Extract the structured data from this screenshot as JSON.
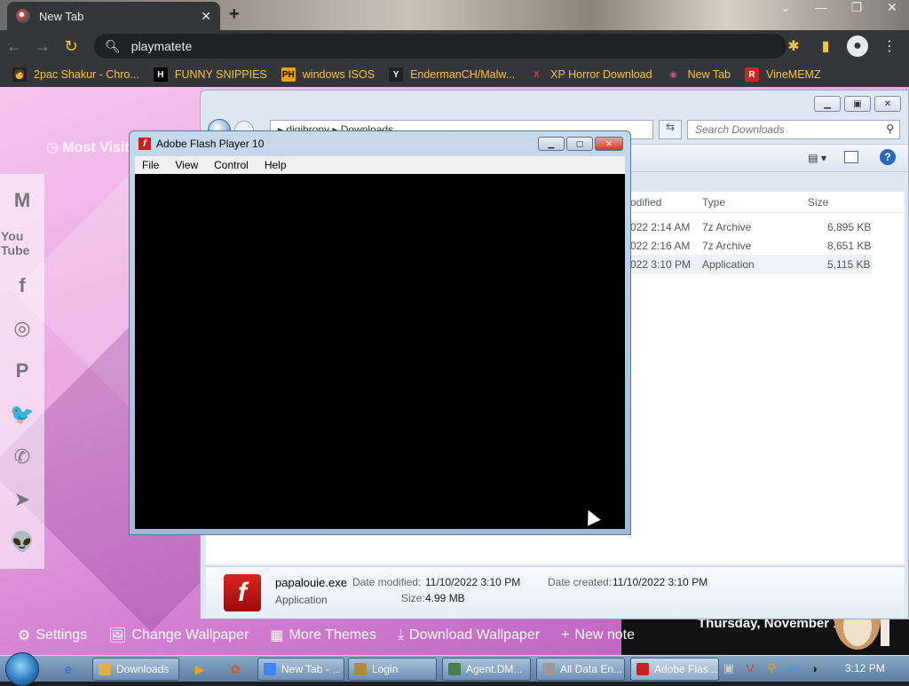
{
  "browser": {
    "tab_title": "New Tab",
    "tab_close": "✕",
    "new_tab_glyph": "+",
    "win_controls": [
      "⌄",
      "—",
      "❐",
      "✕"
    ],
    "omnibox_text": "playmatete",
    "bookmarks": [
      {
        "label": "2pac Shakur - Chro...",
        "icon": "🧑",
        "icon_bg": "#222",
        "icon_color": "#f5c242"
      },
      {
        "label": "FUNNY SNIPPIES",
        "icon": "H",
        "icon_bg": "#000",
        "icon_color": "#fff"
      },
      {
        "label": "windows ISOS",
        "icon": "PH",
        "icon_bg": "#f5a000",
        "icon_color": "#000"
      },
      {
        "label": "EndermanCH/Malw...",
        "icon": "Y",
        "icon_bg": "#222",
        "icon_color": "#fff"
      },
      {
        "label": "XP Horror Download",
        "icon": "X",
        "icon_bg": "transparent",
        "icon_color": "#e53935"
      },
      {
        "label": "New Tab",
        "icon": "◉",
        "icon_bg": "transparent",
        "icon_color": "#c58"
      },
      {
        "label": "VineMEMZ",
        "icon": "R",
        "icon_bg": "#c62828",
        "icon_color": "#fff"
      }
    ]
  },
  "ntp": {
    "most_visited": "Most Visit",
    "social": [
      "M",
      "You Tube",
      "f",
      "◎",
      "P",
      "🐦",
      "✆",
      "➤",
      "👽"
    ],
    "bottom": [
      {
        "icon": "⚙",
        "label": "Settings"
      },
      {
        "icon": "🖼",
        "label": "Change Wallpaper"
      },
      {
        "icon": "▦",
        "label": "More Themes"
      },
      {
        "icon": "⤓",
        "label": "Download Wallpaper"
      },
      {
        "icon": "+",
        "label": "New note"
      }
    ],
    "date": "Thursday, November 10"
  },
  "explorer": {
    "address": "▸ digibrony ▸ Downloads",
    "search_placeholder": "Search Downloads",
    "columns": {
      "modified": "odified",
      "type": "Type",
      "size": "Size"
    },
    "rows": [
      {
        "modified": "022 2:14 AM",
        "type": "7z Archive",
        "size": "6,895 KB",
        "selected": false
      },
      {
        "modified": "022 2:16 AM",
        "type": "7z Archive",
        "size": "8,651 KB",
        "selected": false
      },
      {
        "modified": "022 3:10 PM",
        "type": "Application",
        "size": "5,115 KB",
        "selected": true
      }
    ],
    "details": {
      "name": "papalouie.exe",
      "type": "Application",
      "modified_label": "Date modified:",
      "modified_value": "11/10/2022 3:10 PM",
      "created_label": "Date created:",
      "created_value": "11/10/2022 3:10 PM",
      "size_label": "Size:",
      "size_value": "4.99 MB"
    }
  },
  "flash": {
    "title": "Adobe Flash Player 10",
    "menu": [
      "File",
      "View",
      "Control",
      "Help"
    ]
  },
  "taskbar": {
    "buttons": [
      {
        "label": "Downloads",
        "icon_bg": "#e0b040"
      },
      {
        "label": "New Tab - ...",
        "icon_bg": "#4285f4"
      },
      {
        "label": "Login",
        "icon_bg": "#b08a3a"
      },
      {
        "label": "Agent.DM...",
        "icon_bg": "#4a7d4a"
      },
      {
        "label": "All Data En...",
        "icon_bg": "#999"
      },
      {
        "label": "Adobe Flas...",
        "icon_bg": "#c8201c"
      }
    ],
    "clock": "3:12 PM"
  }
}
